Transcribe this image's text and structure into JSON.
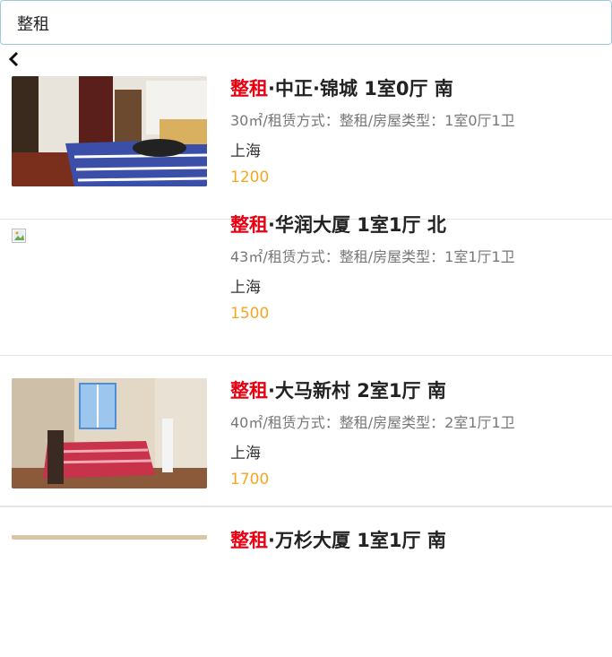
{
  "search": {
    "value": "整租",
    "placeholder": ""
  },
  "nav": {
    "back_icon": "chevron-left-icon"
  },
  "listings": [
    {
      "highlight": "整租",
      "title_rest": "·中正·锦城 1室0厅 南",
      "meta": "30㎡/租赁方式：整租/房屋类型：1室0厅1卫",
      "city": "上海",
      "price": "1200"
    },
    {
      "highlight": "整租",
      "title_rest": "·华润大厦 1室1厅 北",
      "meta": "43㎡/租赁方式：整租/房屋类型：1室1厅1卫",
      "city": "上海",
      "price": "1500"
    },
    {
      "highlight": "整租",
      "title_rest": "·大马新村 2室1厅 南",
      "meta": "40㎡/租赁方式：整租/房屋类型：2室1厅1卫",
      "city": "上海",
      "price": "1700"
    },
    {
      "highlight": "整租",
      "title_rest": "·万杉大厦 1室1厅 南",
      "meta": "",
      "city": "",
      "price": ""
    }
  ]
}
